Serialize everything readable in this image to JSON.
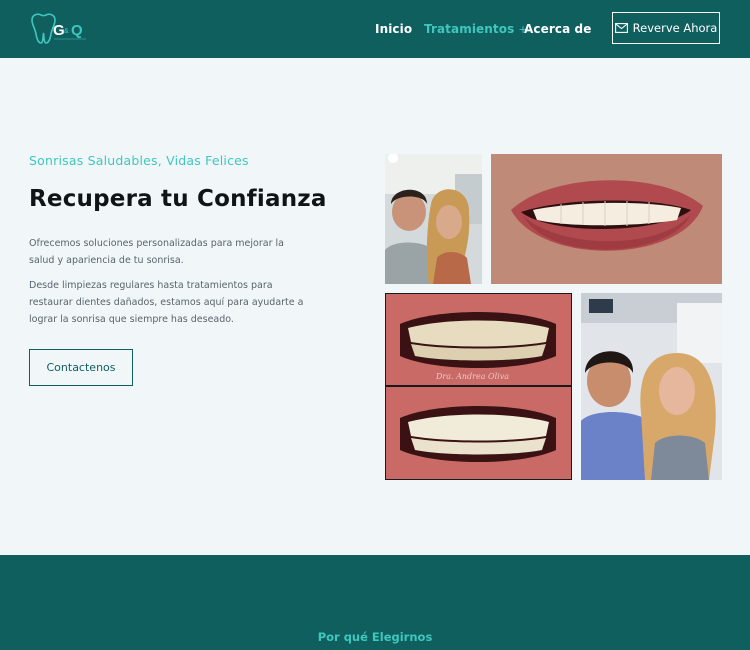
{
  "header": {
    "logo_text": "GQ",
    "nav": [
      {
        "label": "Inicio"
      },
      {
        "label": "Tratamientos",
        "caret": "+"
      },
      {
        "label": "Acerca de"
      }
    ],
    "reserve_button": "Reverve Ahora"
  },
  "hero": {
    "tagline": "Sonrisas Saludables, Vidas Felices",
    "headline": "Recupera tu Confianza",
    "paragraph1": "Ofrecemos soluciones personalizadas para mejorar la salud y apariencia de tu sonrisa.",
    "paragraph2": "Desde limpiezas regulares hasta tratamientos para restaurar dientes dañados, estamos aquí para ayudarte a lograr la sonrisa que siempre has deseado.",
    "contact_button": "Contactenos"
  },
  "gallery": {
    "photo_signature": "Dra. Andrea Oliva"
  },
  "section": {
    "why_title": "Por qué Elegirnos"
  },
  "colors": {
    "brand": "#0f5f5f",
    "accent": "#3fc7be",
    "background": "#f1f6f8"
  }
}
